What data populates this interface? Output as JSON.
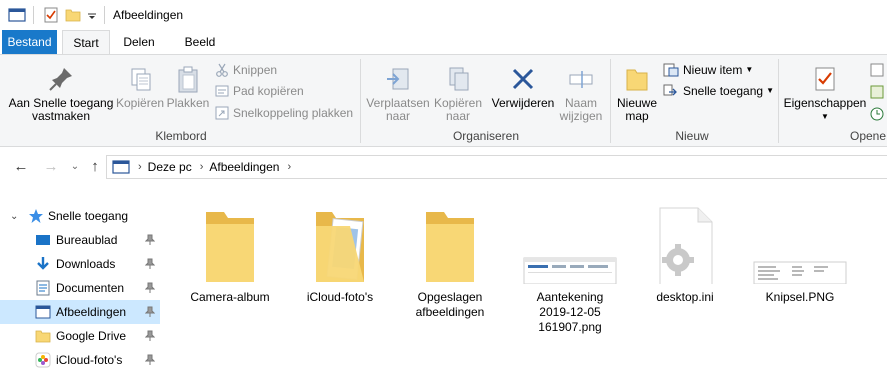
{
  "window": {
    "title": "Afbeeldingen"
  },
  "tabs": {
    "file": "Bestand",
    "start": "Start",
    "share": "Delen",
    "view": "Beeld"
  },
  "ribbon": {
    "clipboard": {
      "pin_label_1": "Aan Snelle toegang",
      "pin_label_2": "vastmaken",
      "copy": "Kopiëren",
      "paste": "Plakken",
      "cut": "Knippen",
      "copy_path": "Pad kopiëren",
      "paste_shortcut": "Snelkoppeling plakken",
      "group": "Klembord"
    },
    "organize": {
      "move_1": "Verplaatsen",
      "move_2": "naar",
      "copy_1": "Kopiëren",
      "copy_2": "naar",
      "delete": "Verwijderen",
      "rename_1": "Naam",
      "rename_2": "wijzigen",
      "group": "Organiseren"
    },
    "new": {
      "new_folder_1": "Nieuwe",
      "new_folder_2": "map",
      "new_item": "Nieuw item",
      "easy_access": "Snelle toegang",
      "group": "Nieuw"
    },
    "open": {
      "properties": "Eigenschappen",
      "group": "Opene"
    }
  },
  "address": {
    "crumbs": [
      "Deze pc",
      "Afbeeldingen"
    ]
  },
  "nav": {
    "quick_access": "Snelle toegang",
    "items": [
      {
        "label": "Bureaublad",
        "icon": "desktop-icon"
      },
      {
        "label": "Downloads",
        "icon": "download-icon"
      },
      {
        "label": "Documenten",
        "icon": "documents-icon"
      },
      {
        "label": "Afbeeldingen",
        "icon": "pictures-icon"
      },
      {
        "label": "Google Drive",
        "icon": "folder-icon"
      },
      {
        "label": "iCloud-foto's",
        "icon": "icloud-photos-icon"
      }
    ]
  },
  "files": [
    {
      "name": "Camera-album",
      "type": "folder"
    },
    {
      "name": "iCloud-foto's",
      "type": "folder-with-content"
    },
    {
      "name_1": "Opgeslagen",
      "name_2": "afbeeldingen",
      "type": "folder"
    },
    {
      "name_1": "Aantekening",
      "name_2": "2019-12-05",
      "name_3": "161907.png",
      "type": "image"
    },
    {
      "name": "desktop.ini",
      "type": "settings-file"
    },
    {
      "name": "Knipsel.PNG",
      "type": "image"
    }
  ],
  "colors": {
    "file_tab": "#1979ca",
    "selection": "#cce8ff",
    "ribbon_bg": "#f5f6f7",
    "folder": "#f8d775",
    "delete_x": "#2b579a"
  }
}
